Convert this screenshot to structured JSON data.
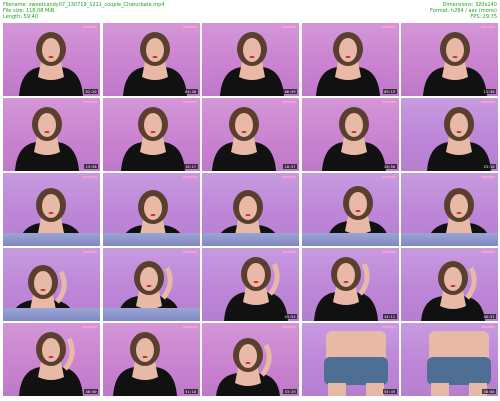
{
  "header": {
    "filename": "Filename: sweetcandy07_130719_1211_couple_Chaturbate.mp4",
    "filesize": "File size: 118.08 MiB",
    "length": "Length: 59:40",
    "dimensions": "Dimensions: 320x240",
    "format": "Format: h264 / aac (mono)",
    "fps": "FPS: 29.75"
  },
  "thumbnails": [
    {
      "time": "02:20"
    },
    {
      "time": "04:40"
    },
    {
      "time": "06:59"
    },
    {
      "time": "09:19"
    },
    {
      "time": "11:38"
    },
    {
      "time": "13:58"
    },
    {
      "time": "16:17"
    },
    {
      "time": "18:37"
    },
    {
      "time": "20:56"
    },
    {
      "time": "23:16"
    },
    {
      "time": "25:35"
    },
    {
      "time": "27:55"
    },
    {
      "time": "30:14"
    },
    {
      "time": "32:34"
    },
    {
      "time": "34:53"
    },
    {
      "time": "37:13"
    },
    {
      "time": "39:32"
    },
    {
      "time": "41:52"
    },
    {
      "time": "44:11"
    },
    {
      "time": "46:31"
    },
    {
      "time": "48:50"
    },
    {
      "time": "51:10"
    },
    {
      "time": "53:29"
    },
    {
      "time": "55:49"
    },
    {
      "time": "58:08"
    }
  ],
  "colors": {
    "header_text": "#1aa51a",
    "timestamp_bg": "#141414",
    "wall_purple": "#c79be0",
    "wall_pink": "#d496d8",
    "hair": "#5a3f2e",
    "skin": "#e7b9a6",
    "clothing": "#111111",
    "shorts": "#4f6e93"
  }
}
